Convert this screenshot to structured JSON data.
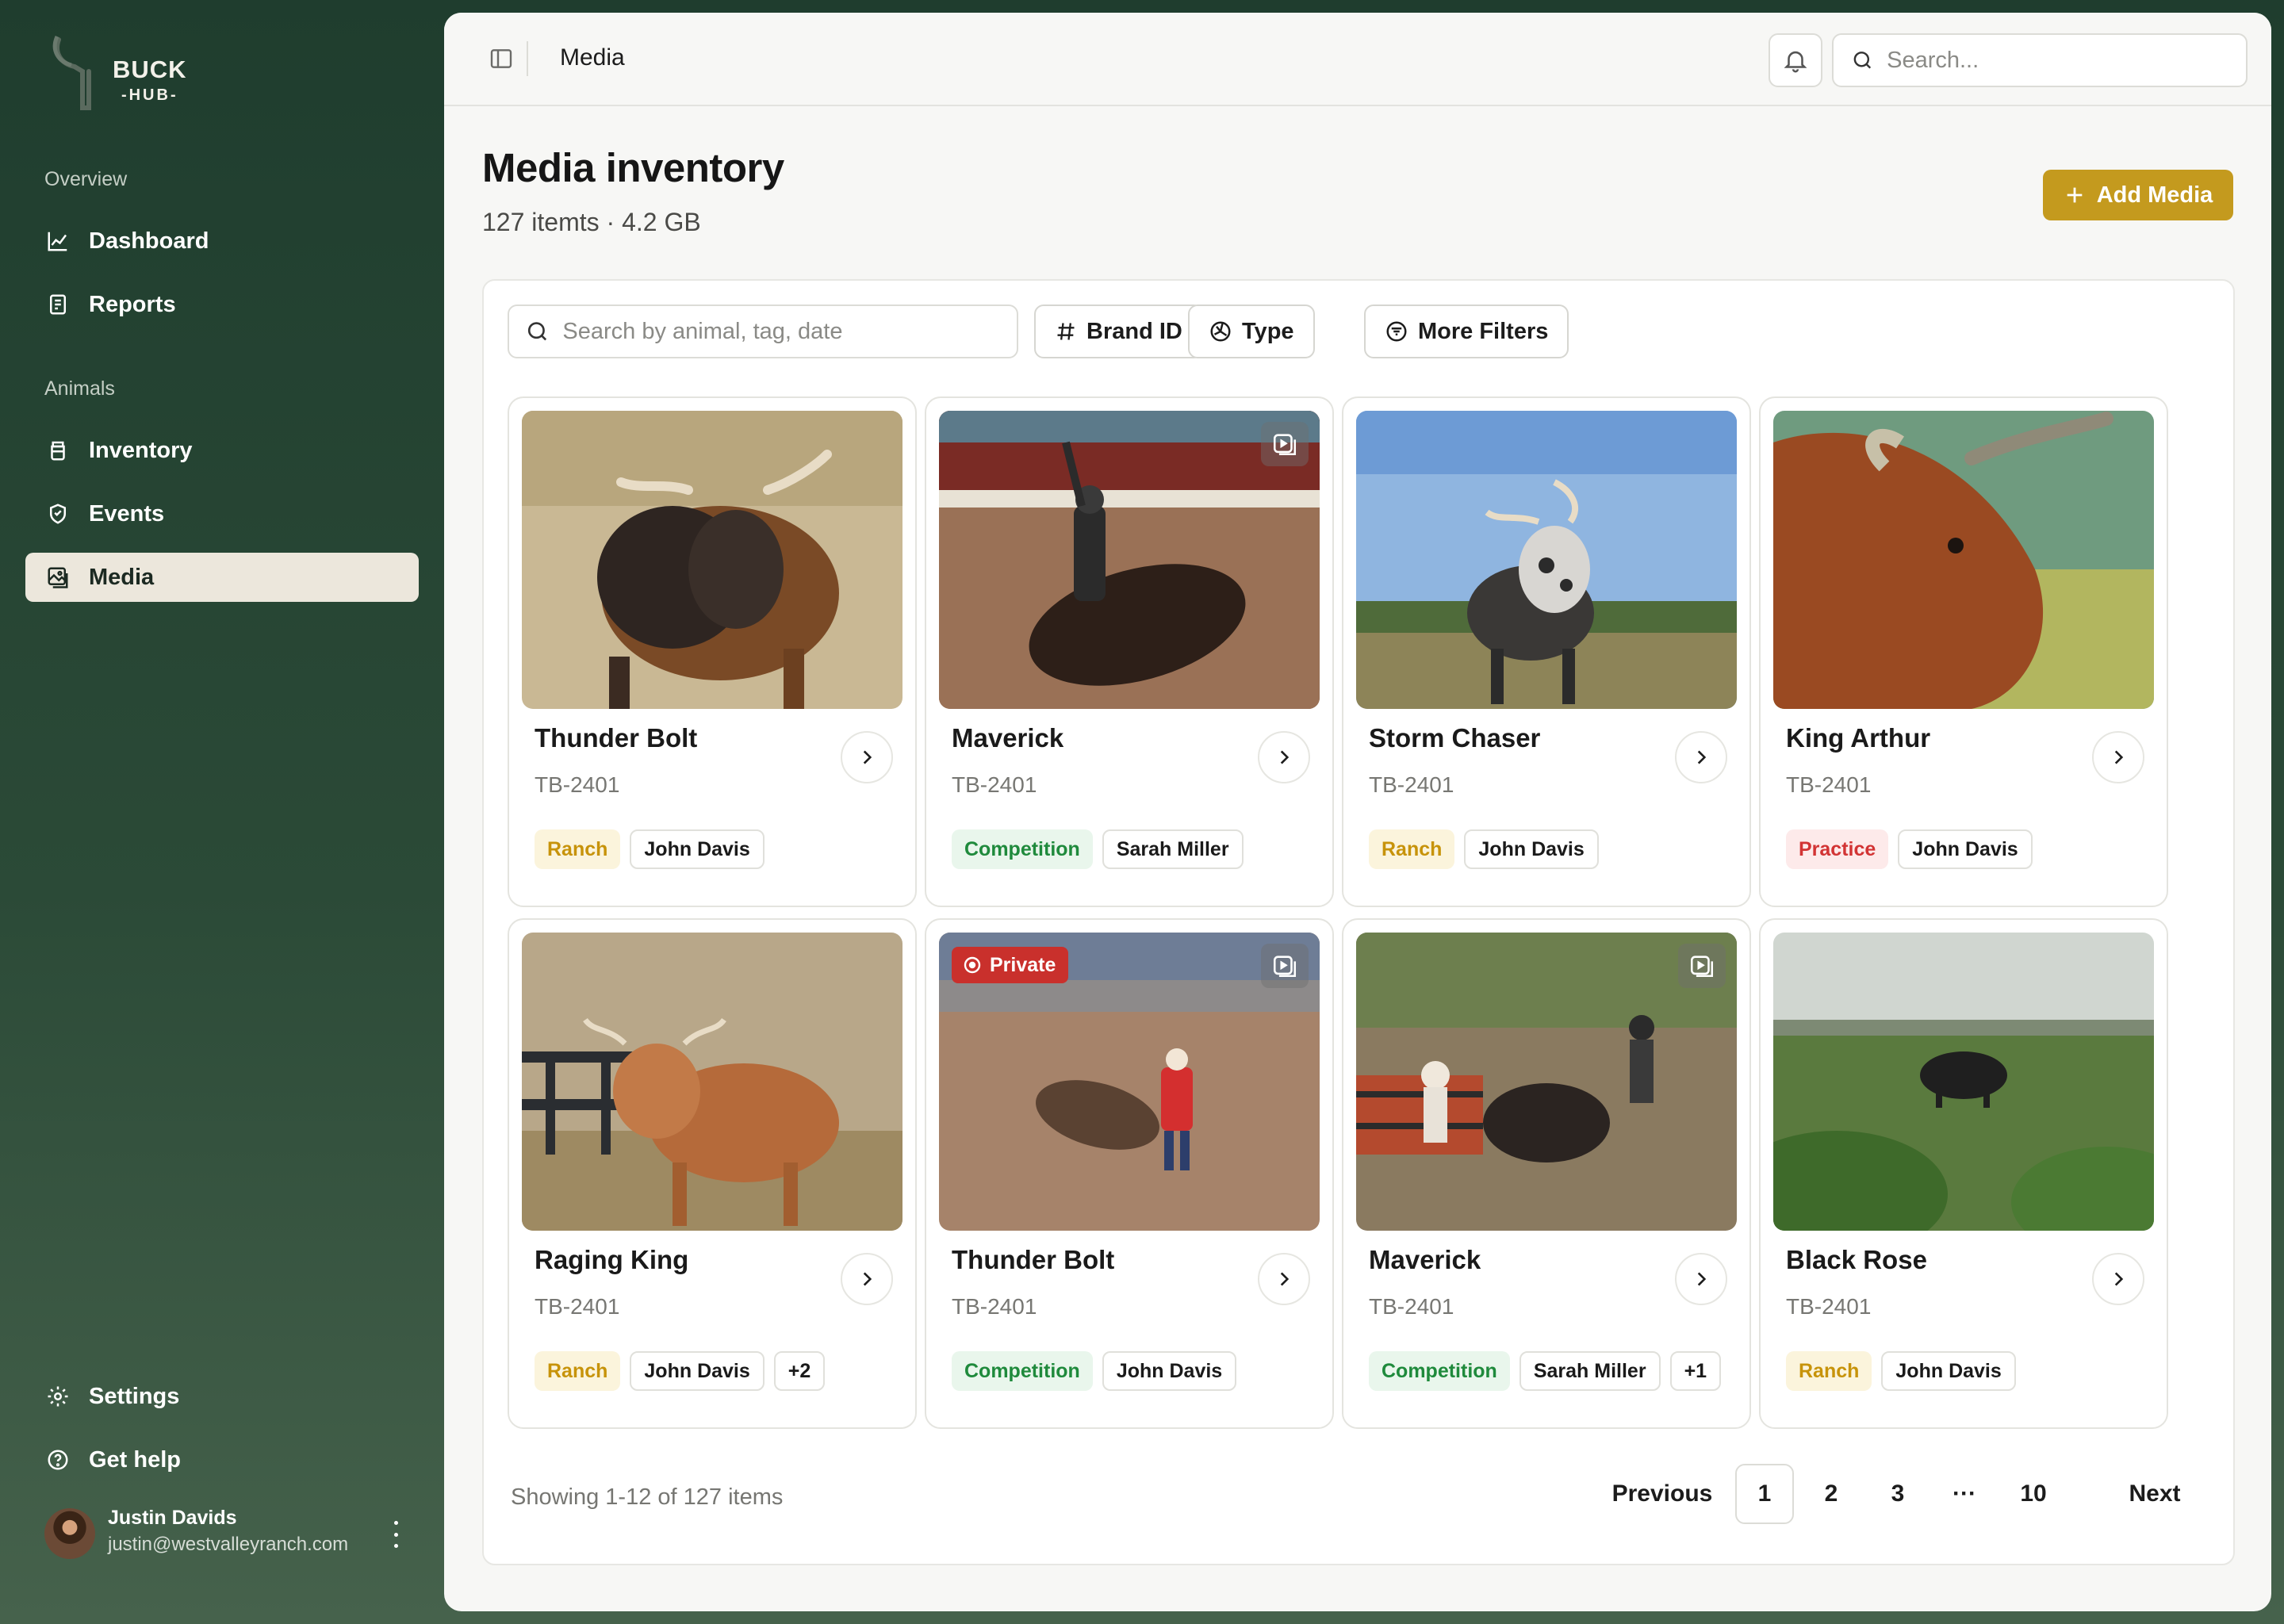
{
  "brand": {
    "name": "BUCK",
    "sub": "-HUB-"
  },
  "sidebar": {
    "sections": [
      {
        "label": "Overview",
        "items": [
          {
            "label": "Dashboard"
          },
          {
            "label": "Reports"
          }
        ]
      },
      {
        "label": "Animals",
        "items": [
          {
            "label": "Inventory"
          },
          {
            "label": "Events"
          },
          {
            "label": "Media",
            "active": true
          }
        ]
      }
    ],
    "footer": [
      {
        "label": "Settings"
      },
      {
        "label": "Get help"
      }
    ],
    "user": {
      "name": "Justin Davids",
      "email": "justin@westvalleyranch.com"
    }
  },
  "topbar": {
    "title": "Media",
    "search_placeholder": "Search..."
  },
  "header": {
    "title": "Media inventory",
    "subtitle": "127 itemts · 4.2 GB",
    "add_button": "Add Media"
  },
  "filters": {
    "search_placeholder": "Search by animal, tag, date",
    "buttons": [
      {
        "label": "Brand ID"
      },
      {
        "label": "Type"
      },
      {
        "label": "More Filters"
      }
    ]
  },
  "cards": [
    {
      "name": "Thunder Bolt",
      "tag": "TB-2401",
      "category": "Ranch",
      "people": [
        "John Davis"
      ],
      "more": "",
      "video": false,
      "private": false,
      "image": "brown-bull-pasture"
    },
    {
      "name": "Maverick",
      "tag": "TB-2401",
      "category": "Competition",
      "people": [
        "Sarah Miller"
      ],
      "more": "",
      "video": true,
      "private": false,
      "image": "rodeo-rider-arena"
    },
    {
      "name": "Storm Chaser",
      "tag": "TB-2401",
      "category": "Ranch",
      "people": [
        "John Davis"
      ],
      "more": "",
      "video": false,
      "private": false,
      "image": "speckled-bull-field"
    },
    {
      "name": "King Arthur",
      "tag": "TB-2401",
      "category": "Practice",
      "people": [
        "John Davis"
      ],
      "more": "",
      "video": false,
      "private": false,
      "image": "grazing-bull-closeup"
    },
    {
      "name": "Raging King",
      "tag": "TB-2401",
      "category": "Ranch",
      "people": [
        "John Davis"
      ],
      "more": "+2",
      "video": false,
      "private": false,
      "image": "brown-cow-fence"
    },
    {
      "name": "Thunder Bolt",
      "tag": "TB-2401",
      "category": "Competition",
      "people": [
        "John Davis"
      ],
      "more": "",
      "video": true,
      "private": true,
      "private_label": "Private",
      "image": "rodeo-clown-arena"
    },
    {
      "name": "Maverick",
      "tag": "TB-2401",
      "category": "Competition",
      "people": [
        "Sarah Miller"
      ],
      "more": "+1",
      "video": true,
      "private": false,
      "image": "rodeo-chute-crowd"
    },
    {
      "name": "Black Rose",
      "tag": "TB-2401",
      "category": "Ranch",
      "people": [
        "John Davis"
      ],
      "more": "",
      "video": false,
      "private": false,
      "image": "black-bull-green-field"
    }
  ],
  "pagination": {
    "summary": "Showing 1-12 of 127 items",
    "previous": "Previous",
    "next": "Next",
    "pages": [
      "1",
      "2",
      "3",
      "···",
      "10"
    ],
    "current": "1"
  },
  "colors": {
    "sidebar": "#1f3d2e",
    "accent": "#c49a1e",
    "active_nav": "#ece7dc",
    "private": "#c9302c"
  }
}
